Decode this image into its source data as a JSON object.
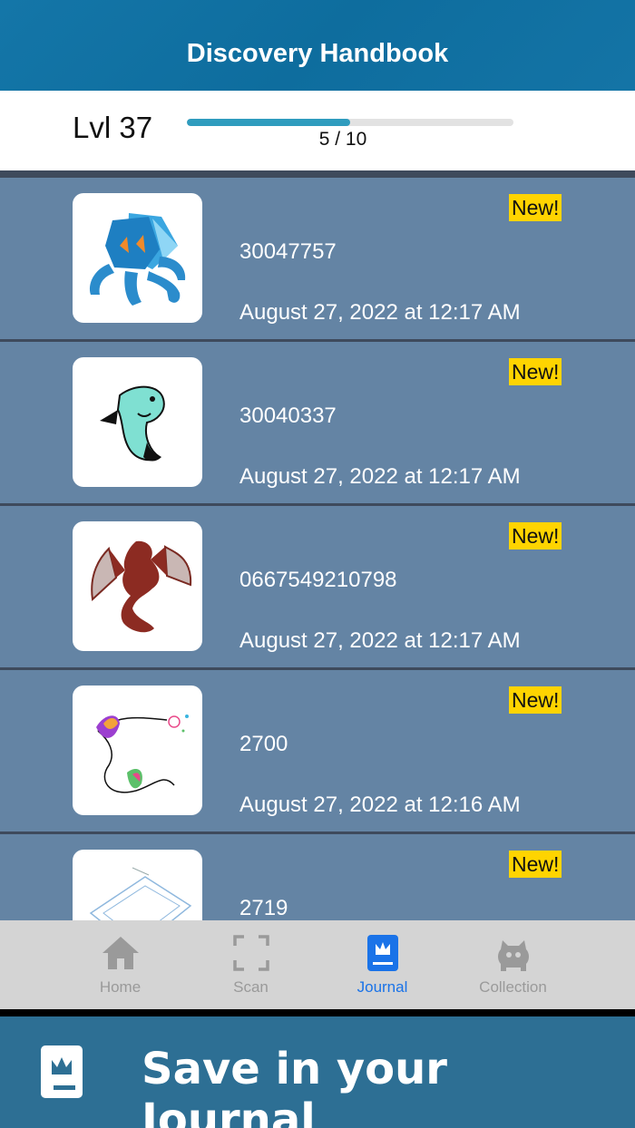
{
  "header": {
    "title": "Discovery Handbook"
  },
  "level": {
    "label": "Lvl 37",
    "progress_text": "5 / 10",
    "progress_fraction": 0.5
  },
  "entries": [
    {
      "badge": "New!",
      "code": "30047757",
      "date": "August 27, 2022 at 12:17 AM",
      "image": "blue-crystal-creature"
    },
    {
      "badge": "New!",
      "code": "30040337",
      "date": "August 27, 2022 at 12:17 AM",
      "image": "teal-fish-creature"
    },
    {
      "badge": "New!",
      "code": "0667549210798",
      "date": "August 27, 2022 at 12:17 AM",
      "image": "red-dragon"
    },
    {
      "badge": "New!",
      "code": "2700",
      "date": "August 27, 2022 at 12:16 AM",
      "image": "colorful-spiral-sketch"
    },
    {
      "badge": "New!",
      "code": "2719",
      "date": "",
      "image": "blue-grid-sketch"
    }
  ],
  "tabs": [
    {
      "label": "Home",
      "icon": "home-icon",
      "active": false
    },
    {
      "label": "Scan",
      "icon": "scan-icon",
      "active": false
    },
    {
      "label": "Journal",
      "icon": "journal-icon",
      "active": true
    },
    {
      "label": "Collection",
      "icon": "monster-icon",
      "active": false
    }
  ],
  "banner": {
    "text": "Save in your Journal",
    "icon": "journal-icon"
  },
  "colors": {
    "header": "#1476a8",
    "row": "#6484a4",
    "badge": "#ffd400",
    "progress": "#2f9cbe",
    "active_tab": "#1a73e8",
    "banner": "#2d6f94"
  }
}
